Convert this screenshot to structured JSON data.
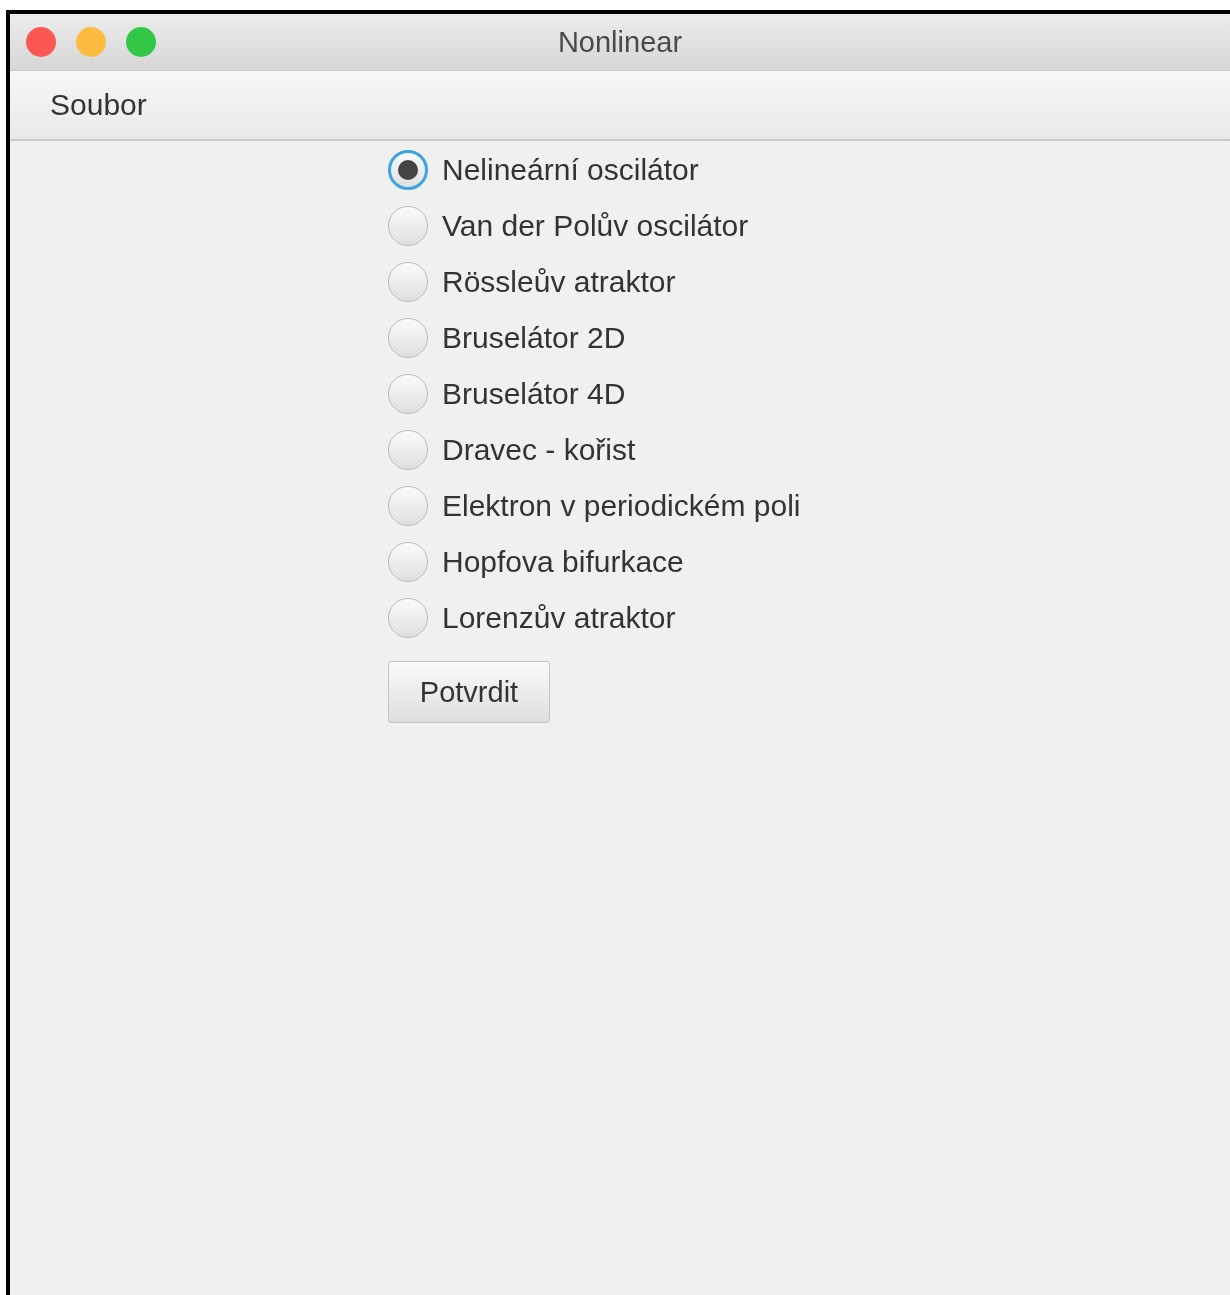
{
  "window": {
    "title": "Nonlinear"
  },
  "menu": [
    "Soubor"
  ],
  "options": [
    {
      "label": "Nelineární oscilátor",
      "selected": true
    },
    {
      "label": "Van der Polův oscilátor",
      "selected": false
    },
    {
      "label": "Rössleův atraktor",
      "selected": false
    },
    {
      "label": "Bruselátor 2D",
      "selected": false
    },
    {
      "label": "Bruselátor 4D",
      "selected": false
    },
    {
      "label": "Dravec - kořist",
      "selected": false
    },
    {
      "label": "Elektron v periodickém poli",
      "selected": false
    },
    {
      "label": "Hopfova bifurkace",
      "selected": false
    },
    {
      "label": "Lorenzův atraktor",
      "selected": false
    }
  ],
  "buttons": [
    "Potvrdit"
  ]
}
